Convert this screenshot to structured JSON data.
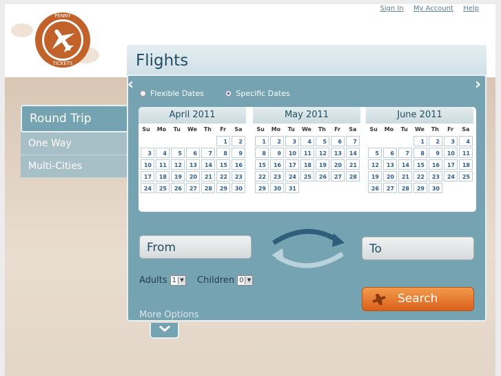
{
  "header": {
    "links": [
      "Sign In",
      "My Account",
      "Help"
    ],
    "logo_text_top": "PENNY",
    "logo_text_bottom": "TICKETS"
  },
  "flights": {
    "title": "Flights",
    "date_modes": [
      {
        "label": "Flexible Dates",
        "selected": false
      },
      {
        "label": "Specific Dates",
        "selected": true
      }
    ]
  },
  "trip_types": [
    "Round Trip",
    "One Way",
    "Multi-Cities"
  ],
  "calendar": {
    "weekdays": [
      "Su",
      "Mo",
      "Tu",
      "We",
      "Th",
      "Fr",
      "Sa"
    ],
    "months": [
      {
        "title": "April 2011",
        "first_weekday": 5,
        "days": 30
      },
      {
        "title": "May 2011",
        "first_weekday": 0,
        "days": 31
      },
      {
        "title": "June 2011",
        "first_weekday": 3,
        "days": 30
      }
    ],
    "prev_label": "‹",
    "next_label": "›"
  },
  "form": {
    "from_placeholder": "From",
    "to_placeholder": "To",
    "adults_label": "Adults",
    "adults_value": "1",
    "children_label": "Children",
    "children_value": "0",
    "search_label": "Search",
    "more_options_label": "More Options"
  },
  "colors": {
    "panel": "#76a3b1",
    "accent_orange": "#e0702a",
    "title_blue": "#1f4d63"
  }
}
